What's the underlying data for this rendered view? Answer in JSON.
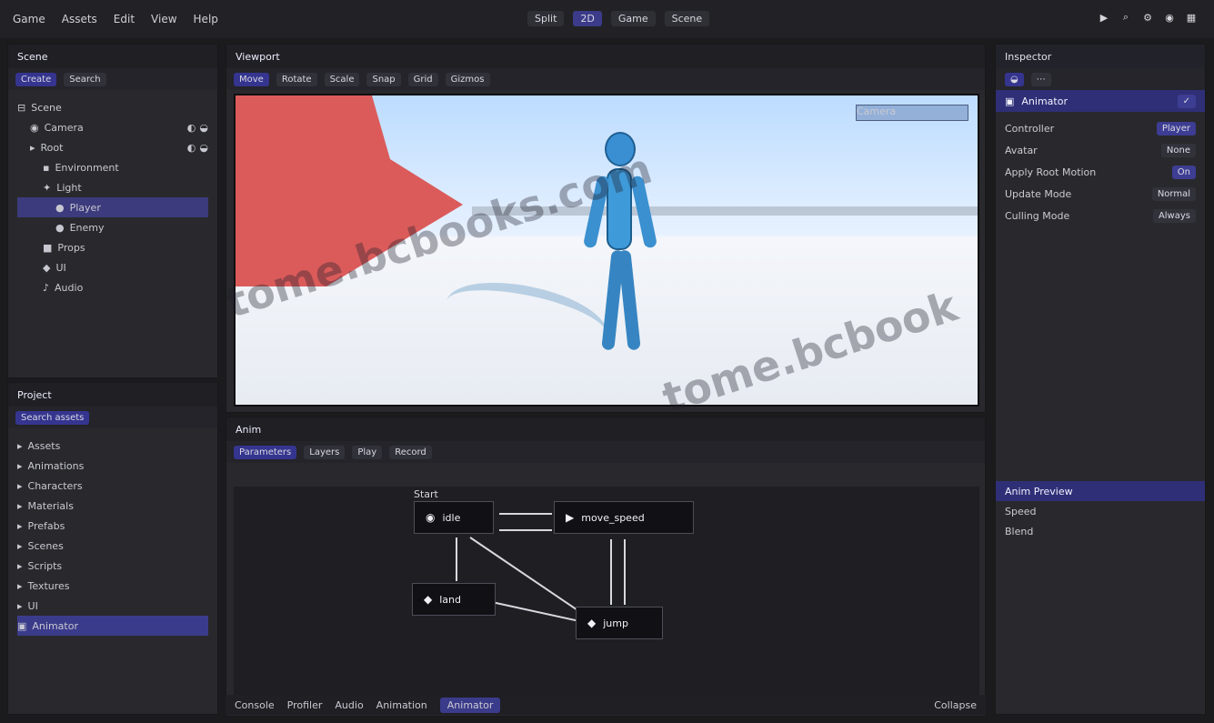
{
  "menubar": {
    "items": [
      "Game",
      "Assets",
      "Edit",
      "View",
      "Help"
    ],
    "center": [
      "Split",
      "2D",
      "Game",
      "Scene"
    ],
    "right_icons": [
      "playback",
      "search",
      "settings",
      "camera",
      "layout"
    ]
  },
  "hierarchy": {
    "title": "Scene",
    "toolbar": [
      "Create",
      "Search"
    ],
    "rows": [
      {
        "label": "Scene",
        "level": 0
      },
      {
        "label": "Camera",
        "level": 1
      },
      {
        "label": "Root",
        "level": 1
      },
      {
        "label": "Environment",
        "level": 2
      },
      {
        "label": "Light",
        "level": 2
      },
      {
        "label": "Player",
        "level": 3
      },
      {
        "label": "Enemy",
        "level": 3
      },
      {
        "label": "Props",
        "level": 2
      },
      {
        "label": "UI",
        "level": 2
      },
      {
        "label": "Audio",
        "level": 2
      }
    ],
    "selected": "Player"
  },
  "project": {
    "title": "Project",
    "search_placeholder": "Search assets",
    "rows": [
      "Assets",
      "Animations",
      "Characters",
      "Materials",
      "Prefabs",
      "Scenes",
      "Scripts",
      "Textures",
      "UI",
      "Animator"
    ],
    "selected": "Animator"
  },
  "scene": {
    "title": "Viewport",
    "toolbar": [
      "Move",
      "Rotate",
      "Scale",
      "Snap",
      "Grid",
      "Gizmos"
    ],
    "overlay_chip": "Camera"
  },
  "animator": {
    "title": "Anim",
    "toolbar": [
      "Parameters",
      "Layers",
      "Play",
      "Record"
    ],
    "graph_label": "Start",
    "nodes": [
      {
        "label": "idle"
      },
      {
        "label": "move_speed"
      },
      {
        "label": "land"
      },
      {
        "label": "jump"
      }
    ]
  },
  "inspector": {
    "title": "Inspector",
    "header": "Animator",
    "rows": [
      {
        "label": "Controller",
        "value": "Player"
      },
      {
        "label": "Avatar",
        "value": "None"
      },
      {
        "label": "Apply Root Motion",
        "value": "On"
      },
      {
        "label": "Update Mode",
        "value": "Normal"
      },
      {
        "label": "Culling Mode",
        "value": "Always"
      }
    ],
    "bottom_header": "Anim Preview",
    "bottom_rows": [
      "Speed",
      "Blend"
    ]
  },
  "status": {
    "tabs": [
      "Console",
      "Profiler",
      "Audio",
      "Animation",
      "Animator"
    ],
    "selected": "Animator",
    "right": "Collapse"
  },
  "watermarks": [
    "tome.bcbooks.com",
    "tome.bcbook"
  ]
}
